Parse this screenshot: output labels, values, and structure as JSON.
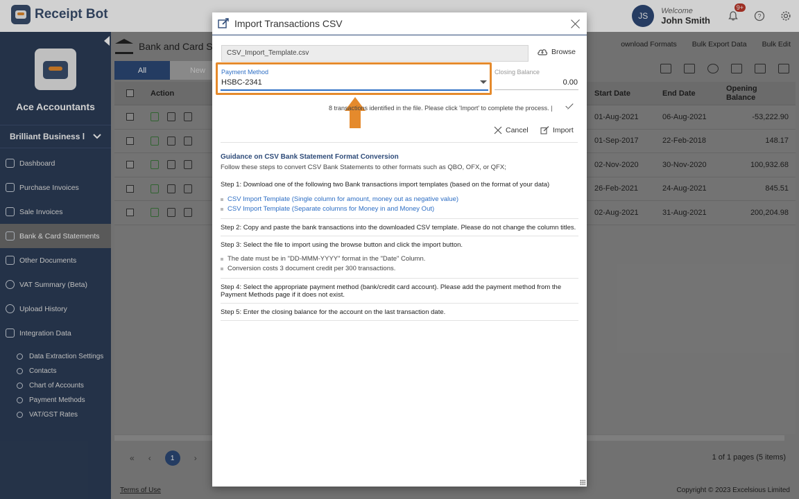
{
  "app": {
    "logo_text": "Receipt Bot",
    "user_initials": "JS",
    "welcome_label": "Welcome",
    "user_name": "John Smith",
    "notification_badge": "9+"
  },
  "sidebar": {
    "org_name": "Ace Accountants",
    "company": "Brilliant Business l",
    "items": [
      {
        "label": "Dashboard",
        "icon": "gauge-icon"
      },
      {
        "label": "Purchase Invoices",
        "icon": "invoice-icon"
      },
      {
        "label": "Sale Invoices",
        "icon": "sale-icon"
      },
      {
        "label": "Bank & Card Statements",
        "icon": "bank-icon"
      },
      {
        "label": "Other Documents",
        "icon": "document-icon"
      },
      {
        "label": "VAT Summary (Beta)",
        "icon": "percent-icon"
      },
      {
        "label": "Upload History",
        "icon": "upload-icon"
      },
      {
        "label": "Integration Data",
        "icon": "link-icon"
      }
    ],
    "subitems": [
      "Data Extraction Settings",
      "Contacts",
      "Chart of Accounts",
      "Payment Methods",
      "VAT/GST Rates"
    ]
  },
  "page": {
    "title": "Bank and Card S",
    "actions": [
      "ownload Formats",
      "Bulk Export Data",
      "Bulk Edit"
    ],
    "tabs": [
      "All",
      "New"
    ],
    "columns": {
      "action": "Action",
      "start": "Start Date",
      "end": "End Date",
      "opening": "Opening Balance"
    },
    "rows": [
      {
        "start": "01-Aug-2021",
        "end": "06-Aug-2021",
        "opening": "-53,222.90"
      },
      {
        "start": "01-Sep-2017",
        "end": "22-Feb-2018",
        "opening": "148.17"
      },
      {
        "start": "02-Nov-2020",
        "end": "30-Nov-2020",
        "opening": "100,932.68"
      },
      {
        "start": "26-Feb-2021",
        "end": "24-Aug-2021",
        "opening": "845.51"
      },
      {
        "start": "02-Aug-2021",
        "end": "31-Aug-2021",
        "opening": "200,204.98"
      }
    ],
    "current_page": "1",
    "pager_info": "1 of 1 pages (5 items)",
    "terms": "Terms of Use",
    "copyright": "Copyright © 2023 Excelsious Limited"
  },
  "modal": {
    "title": "Import Transactions CSV",
    "file_name": "CSV_Import_Template.csv",
    "browse_label": "Browse",
    "payment_method_label": "Payment Method",
    "payment_method_value": "HSBC-2341",
    "closing_balance_label": "Closing Balance",
    "closing_balance_value": "0.00",
    "status_text": "8 transactions identified in the file. Please click 'Import' to complete the process. |",
    "cancel_label": "Cancel",
    "import_label": "Import",
    "guide_title": "Guidance on CSV Bank Statement Format Conversion",
    "guide_intro": "Follow these steps to convert CSV Bank Statements to other formats such as QBO, OFX, or QFX;",
    "step1": "Step 1: Download one of the following two Bank transactions import templates (based on the format of your data)",
    "step1_links": [
      "CSV Import Template (Single column for amount, money out as negative value)",
      "CSV Import Template (Separate columns for Money in and Money Out)"
    ],
    "step2": "Step 2: Copy and paste the bank transactions into the downloaded CSV template. Please do not change the column titles.",
    "step3": "Step 3: Select the file to import using the browse button and click the import button.",
    "step3_notes": [
      "The date must be in \"DD-MMM-YYYY\" format in the \"Date\" Column.",
      "Conversion costs 3 document credit per 300 transactions."
    ],
    "step4": "Step 4: Select the appropriate payment method (bank/credit card account). Please add the payment method from the Payment Methods page if it does not exist.",
    "step5": "Step 5: Enter the closing balance for the account on the last transaction date."
  },
  "colors": {
    "highlight": "#e58a2c",
    "primary": "#2d4a78",
    "link": "#2d6ec4",
    "sidebar_bg": "#2d3e58"
  }
}
